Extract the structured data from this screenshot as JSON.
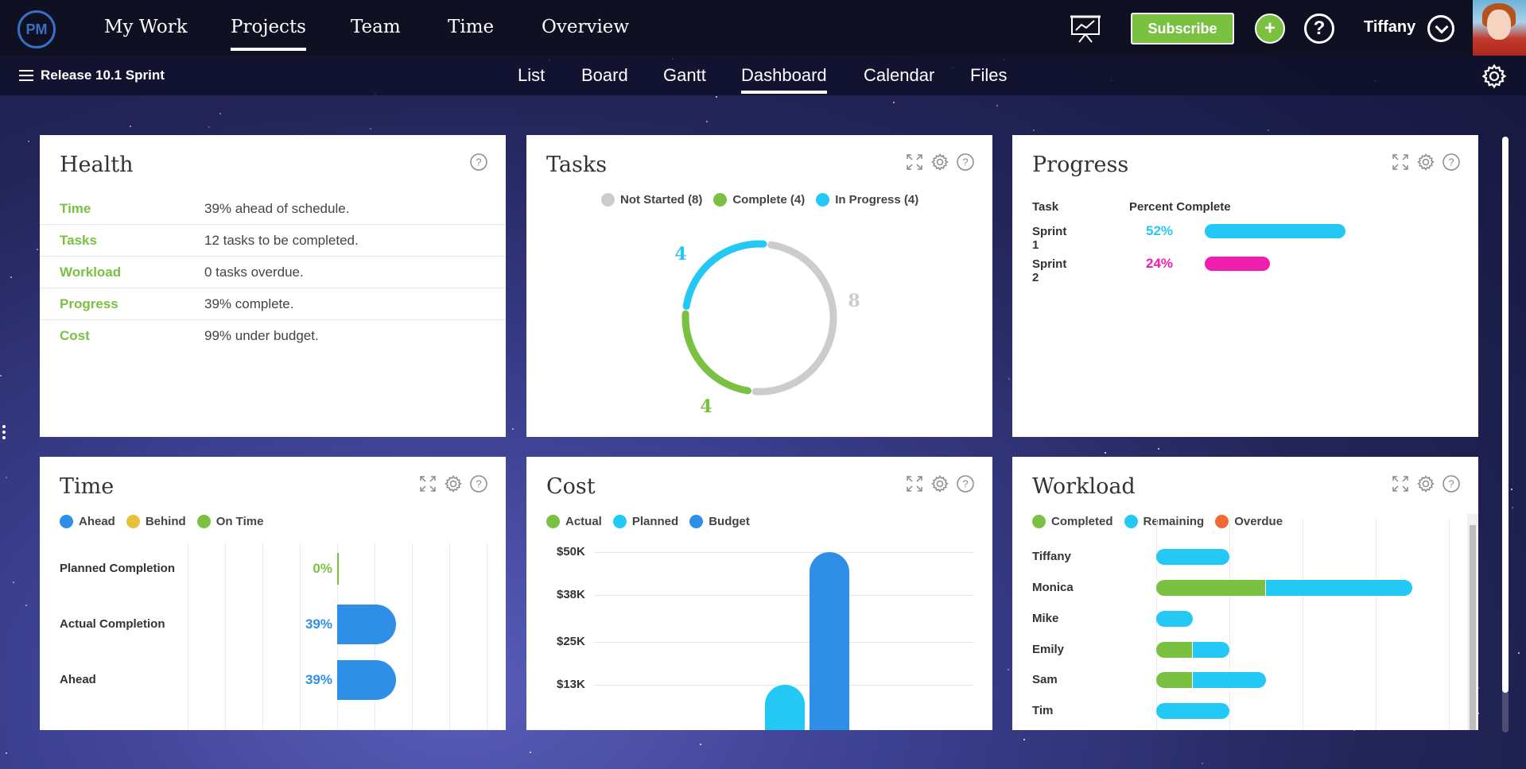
{
  "topnav": {
    "logo": "PM",
    "links": [
      "My Work",
      "Projects",
      "Team",
      "Time",
      "Overview"
    ],
    "active_link": "Projects",
    "subscribe_label": "Subscribe",
    "plus_label": "+",
    "help_label": "?",
    "user_name": "Tiffany"
  },
  "subnav": {
    "project_name": "Release 10.1 Sprint",
    "tabs": [
      "List",
      "Board",
      "Gantt",
      "Dashboard",
      "Calendar",
      "Files"
    ],
    "active_tab": "Dashboard"
  },
  "colors": {
    "green": "#7ac142",
    "cyan": "#23c9f4",
    "blue": "#2f8fe6",
    "gray": "#cccccc",
    "magenta": "#f01eac",
    "yellow": "#e8c13a",
    "orange": "#f06a33"
  },
  "health": {
    "title": "Health",
    "rows": [
      {
        "label": "Time",
        "value": "39% ahead of schedule."
      },
      {
        "label": "Tasks",
        "value": "12 tasks to be completed."
      },
      {
        "label": "Workload",
        "value": "0 tasks overdue."
      },
      {
        "label": "Progress",
        "value": "39% complete."
      },
      {
        "label": "Cost",
        "value": "99% under budget."
      }
    ]
  },
  "tasks": {
    "title": "Tasks",
    "legend": [
      "Not Started (8)",
      "Complete (4)",
      "In Progress (4)"
    ]
  },
  "progress": {
    "title": "Progress",
    "col_task": "Task",
    "col_percent": "Percent Complete",
    "rows": [
      {
        "name": "Sprint 1",
        "pct_label": "52%",
        "value": 52
      },
      {
        "name": "Sprint 2",
        "pct_label": "24%",
        "value": 24
      }
    ]
  },
  "time": {
    "title": "Time",
    "legend": [
      "Ahead",
      "Behind",
      "On Time"
    ]
  },
  "cost": {
    "title": "Cost",
    "legend": [
      "Actual",
      "Planned",
      "Budget"
    ]
  },
  "workload": {
    "title": "Workload",
    "legend": [
      "Completed",
      "Remaining",
      "Overdue"
    ]
  },
  "chart_data": [
    {
      "type": "pie",
      "chart": "tasks-donut",
      "categories": [
        "Not Started",
        "Complete",
        "In Progress"
      ],
      "values": [
        8,
        4,
        4
      ],
      "data_labels": [
        "8",
        "4",
        "4"
      ]
    },
    {
      "type": "bar",
      "chart": "time",
      "categories": [
        "Planned Completion",
        "Actual Completion",
        "Ahead"
      ],
      "values": [
        0,
        39,
        39
      ],
      "data_labels": [
        "0%",
        "39%",
        "39%"
      ]
    },
    {
      "type": "bar",
      "chart": "cost",
      "yticks": [
        "$50K",
        "$38K",
        "$25K",
        "$13K"
      ],
      "ylim": [
        0,
        50
      ],
      "series": [
        {
          "name": "Planned",
          "values": [
            13
          ]
        },
        {
          "name": "Budget",
          "values": [
            50
          ]
        }
      ]
    },
    {
      "type": "bar",
      "chart": "workload",
      "categories": [
        "Tiffany",
        "Monica",
        "Mike",
        "Emily",
        "Sam",
        "Tim"
      ],
      "series": [
        {
          "name": "Completed",
          "values": [
            0,
            3,
            0,
            1,
            1,
            0
          ]
        },
        {
          "name": "Remaining",
          "values": [
            2,
            4,
            1,
            1,
            2,
            2
          ]
        },
        {
          "name": "Overdue",
          "values": [
            0,
            0,
            0,
            0,
            0,
            0
          ]
        }
      ]
    }
  ]
}
